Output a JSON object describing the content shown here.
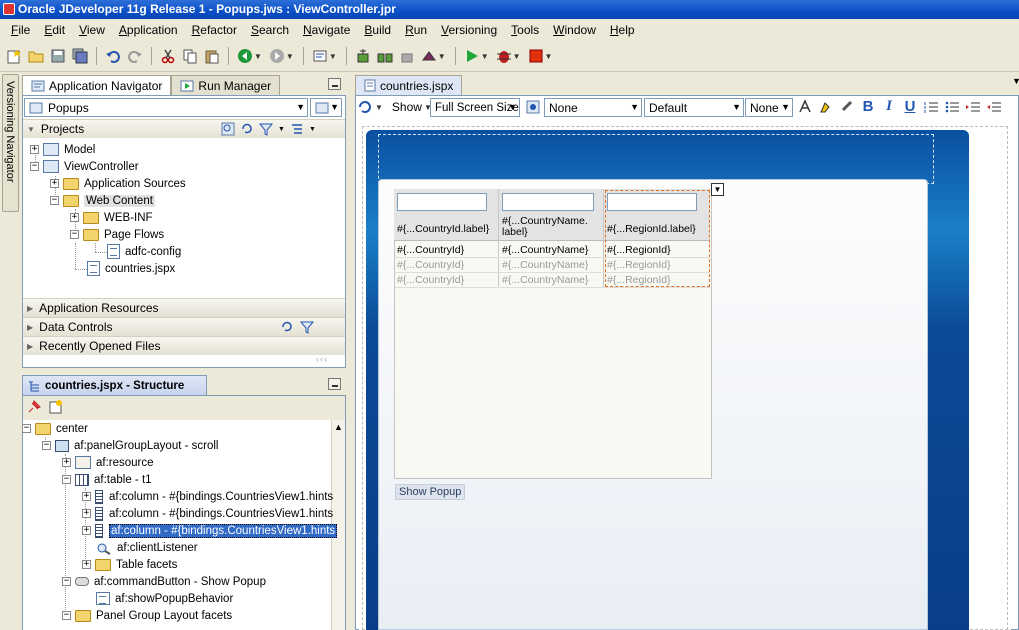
{
  "window": {
    "title": "Oracle JDeveloper 11g Release 1 - Popups.jws : ViewController.jpr"
  },
  "menu": [
    "File",
    "Edit",
    "View",
    "Application",
    "Refactor",
    "Search",
    "Navigate",
    "Build",
    "Run",
    "Versioning",
    "Tools",
    "Window",
    "Help"
  ],
  "toolbar": {
    "icons": [
      "new",
      "open",
      "save",
      "save-all",
      "undo",
      "redo",
      "cut",
      "copy",
      "paste",
      "back",
      "forward",
      "make",
      "rebuild",
      "clean",
      "deploy",
      "run",
      "debug",
      "stop"
    ]
  },
  "versioning_navigator": {
    "label": "Versioning Navigator"
  },
  "navigator": {
    "tabs": [
      "Application Navigator",
      "Run Manager"
    ],
    "application": "Popups",
    "projects_label": "Projects",
    "tree": [
      "Model",
      "ViewController",
      "Application Sources",
      "Web Content",
      "WEB-INF",
      "Page Flows",
      "adfc-config",
      "countries.jspx"
    ],
    "sections": [
      "Application Resources",
      "Data Controls",
      "Recently Opened Files"
    ]
  },
  "structure": {
    "title": "countries.jspx - Structure",
    "tree": [
      "center",
      "af:panelGroupLayout - scroll",
      "af:resource",
      "af:table - t1",
      "af:column - #{bindings.CountriesView1.hints",
      "af:column - #{bindings.CountriesView1.hints",
      "af:column - #{bindings.CountriesView1.hints",
      "af:clientListener",
      "Table facets",
      "af:commandButton - Show Popup",
      "af:showPopupBehavior",
      "Panel Group Layout facets"
    ]
  },
  "editor": {
    "tab": "countries.jspx",
    "toolbar": {
      "show_label": "Show",
      "screen_size": "Full Screen Size",
      "combo1": "None",
      "combo2": "Default",
      "combo3": "None"
    },
    "table": {
      "headers": [
        "#{...CountryId.label}",
        "#{...CountryName.\nlabel}",
        "#{...RegionId.label}"
      ],
      "rows": [
        [
          "#{...CountryId}",
          "#{...CountryName}",
          "#{...RegionId}"
        ],
        [
          "#{...CountryId}",
          "#{...CountryName}",
          "#{...RegionId}"
        ],
        [
          "#{...CountryId}",
          "#{...CountryName}",
          "#{...RegionId}"
        ]
      ]
    },
    "button": "Show Popup"
  }
}
